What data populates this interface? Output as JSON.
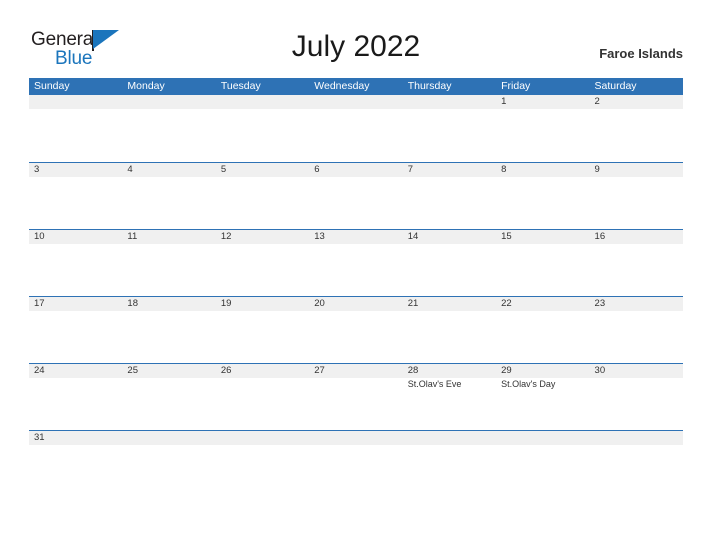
{
  "brand": {
    "name_part1": "General",
    "name_part2": "Blue",
    "accent_color": "#1b75bc"
  },
  "header": {
    "title": "July 2022",
    "region": "Faroe Islands",
    "header_bg_color": "#2e72b5",
    "date_band_color": "#f0f0f0"
  },
  "weekdays": [
    "Sunday",
    "Monday",
    "Tuesday",
    "Wednesday",
    "Thursday",
    "Friday",
    "Saturday"
  ],
  "weeks": [
    [
      {
        "day": "",
        "events": []
      },
      {
        "day": "",
        "events": []
      },
      {
        "day": "",
        "events": []
      },
      {
        "day": "",
        "events": []
      },
      {
        "day": "",
        "events": []
      },
      {
        "day": "1",
        "events": []
      },
      {
        "day": "2",
        "events": []
      }
    ],
    [
      {
        "day": "3",
        "events": []
      },
      {
        "day": "4",
        "events": []
      },
      {
        "day": "5",
        "events": []
      },
      {
        "day": "6",
        "events": []
      },
      {
        "day": "7",
        "events": []
      },
      {
        "day": "8",
        "events": []
      },
      {
        "day": "9",
        "events": []
      }
    ],
    [
      {
        "day": "10",
        "events": []
      },
      {
        "day": "11",
        "events": []
      },
      {
        "day": "12",
        "events": []
      },
      {
        "day": "13",
        "events": []
      },
      {
        "day": "14",
        "events": []
      },
      {
        "day": "15",
        "events": []
      },
      {
        "day": "16",
        "events": []
      }
    ],
    [
      {
        "day": "17",
        "events": []
      },
      {
        "day": "18",
        "events": []
      },
      {
        "day": "19",
        "events": []
      },
      {
        "day": "20",
        "events": []
      },
      {
        "day": "21",
        "events": []
      },
      {
        "day": "22",
        "events": []
      },
      {
        "day": "23",
        "events": []
      }
    ],
    [
      {
        "day": "24",
        "events": []
      },
      {
        "day": "25",
        "events": []
      },
      {
        "day": "26",
        "events": []
      },
      {
        "day": "27",
        "events": []
      },
      {
        "day": "28",
        "events": [
          "St.Olav's Eve"
        ]
      },
      {
        "day": "29",
        "events": [
          "St.Olav's Day"
        ]
      },
      {
        "day": "30",
        "events": []
      }
    ],
    [
      {
        "day": "31",
        "events": []
      },
      {
        "day": "",
        "events": []
      },
      {
        "day": "",
        "events": []
      },
      {
        "day": "",
        "events": []
      },
      {
        "day": "",
        "events": []
      },
      {
        "day": "",
        "events": []
      },
      {
        "day": "",
        "events": []
      }
    ]
  ]
}
